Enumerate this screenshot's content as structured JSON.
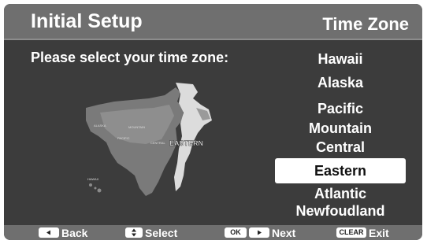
{
  "header": {
    "title": "Initial Setup",
    "section": "Time Zone"
  },
  "prompt": "Please select your time zone:",
  "map": {
    "highlight_label": "EASTERN",
    "region_labels": [
      "ALASKA",
      "MOUNTAIN",
      "PACIFIC",
      "CENTRAL",
      "HAWAII"
    ]
  },
  "zones": {
    "items": [
      {
        "label": "Hawaii",
        "selected": false
      },
      {
        "label": "Alaska",
        "selected": false
      },
      {
        "label": "Pacific",
        "selected": false
      },
      {
        "label": "Mountain",
        "selected": false
      },
      {
        "label": "Central",
        "selected": false
      },
      {
        "label": "Eastern",
        "selected": true
      },
      {
        "label": "Atlantic",
        "selected": false
      },
      {
        "label": "Newfoudland",
        "selected": false
      }
    ]
  },
  "footer": {
    "back_label": "Back",
    "select_label": "Select",
    "ok_key": "OK",
    "next_label": "Next",
    "clear_key": "CLEAR",
    "exit_label": "Exit"
  },
  "colors": {
    "panel": "#3c3c3c",
    "bar": "#6f6f6f",
    "selection": "#ffffff"
  }
}
